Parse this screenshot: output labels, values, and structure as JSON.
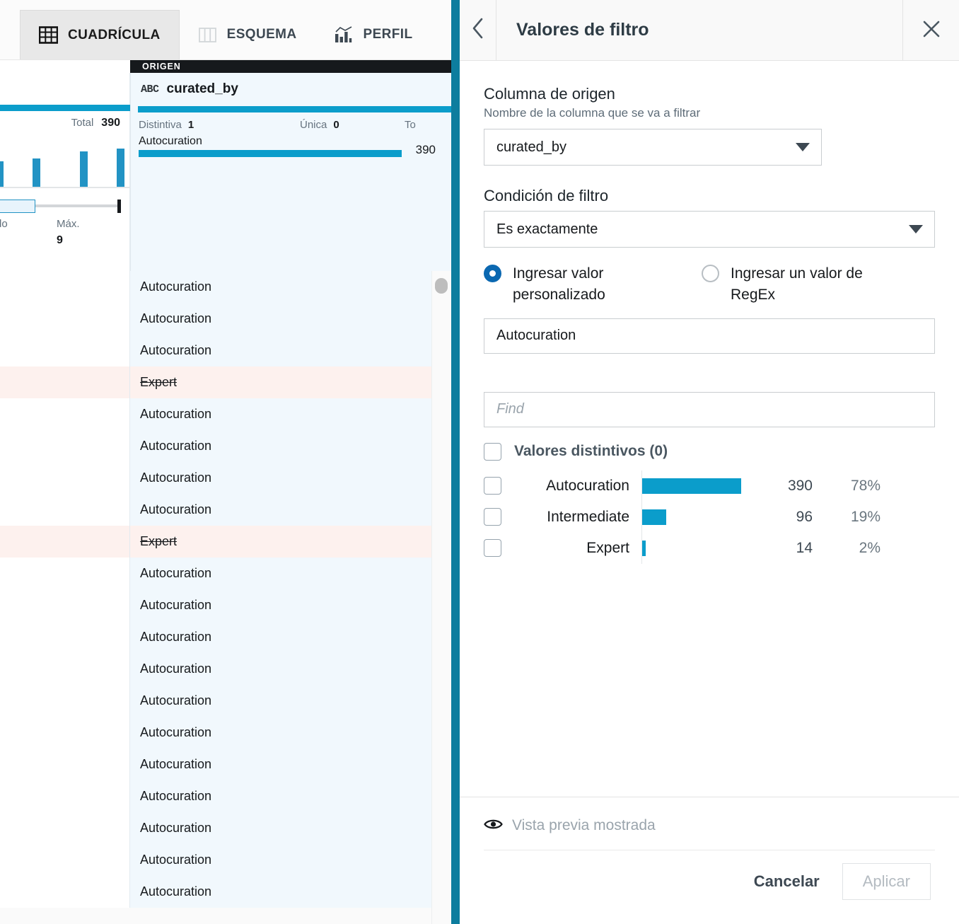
{
  "tabs": [
    {
      "id": "grid",
      "label": "CUADRÍCULA",
      "icon": "grid-icon",
      "active": true
    },
    {
      "id": "schema",
      "label": "ESQUEMA",
      "icon": "columns-icon",
      "active": false
    },
    {
      "id": "profile",
      "label": "PERFIL",
      "icon": "bar-chart-icon",
      "active": false
    }
  ],
  "profile": {
    "origin_label": "ORIGEN",
    "type_badge": "ABC",
    "column_name": "curated_by",
    "stats": [
      {
        "label": "Distintiva",
        "value": "1"
      },
      {
        "label": "Única",
        "value": "0"
      },
      {
        "label": "To",
        "value": ""
      }
    ],
    "value_name": "Autocuration",
    "value_count": "390",
    "left_card": {
      "total_label": "Total",
      "total_value": "390",
      "mode_label": "do",
      "max_label": "Máx.",
      "max_value": "9"
    }
  },
  "grid": {
    "rows": [
      {
        "value": "Autocuration",
        "struck": false
      },
      {
        "value": "Autocuration",
        "struck": false
      },
      {
        "value": "Autocuration",
        "struck": false
      },
      {
        "value": "Expert",
        "struck": true
      },
      {
        "value": "Autocuration",
        "struck": false
      },
      {
        "value": "Autocuration",
        "struck": false
      },
      {
        "value": "Autocuration",
        "struck": false
      },
      {
        "value": "Autocuration",
        "struck": false
      },
      {
        "value": "Expert",
        "struck": true
      },
      {
        "value": "Autocuration",
        "struck": false
      },
      {
        "value": "Autocuration",
        "struck": false
      },
      {
        "value": "Autocuration",
        "struck": false
      },
      {
        "value": "Autocuration",
        "struck": false
      },
      {
        "value": "Autocuration",
        "struck": false
      },
      {
        "value": "Autocuration",
        "struck": false
      },
      {
        "value": "Autocuration",
        "struck": false
      },
      {
        "value": "Autocuration",
        "struck": false
      },
      {
        "value": "Autocuration",
        "struck": false
      },
      {
        "value": "Autocuration",
        "struck": false
      },
      {
        "value": "Autocuration",
        "struck": false
      }
    ]
  },
  "panel": {
    "title": "Valores de filtro",
    "back_icon": "chevron-left-icon",
    "close_icon": "close-icon",
    "source_column": {
      "label": "Columna de origen",
      "sublabel": "Nombre de la columna que se va a filtrar",
      "value": "curated_by"
    },
    "condition": {
      "label": "Condición de filtro",
      "value": "Es exactamente"
    },
    "mode_options": [
      {
        "id": "custom",
        "label": "Ingresar valor personalizado",
        "selected": true
      },
      {
        "id": "regex",
        "label": "Ingresar un valor de RegEx",
        "selected": false
      }
    ],
    "value_input": "Autocuration",
    "find_placeholder": "Find",
    "distinct_header": "Valores distintivos (0)",
    "footer": {
      "preview_icon": "eye-icon",
      "preview_text": "Vista previa mostrada",
      "cancel_label": "Cancelar",
      "apply_label": "Aplicar"
    }
  },
  "chart_data": {
    "type": "bar",
    "title": "Valores distintivos (0)",
    "orientation": "horizontal",
    "categories": [
      "Autocuration",
      "Intermediate",
      "Expert"
    ],
    "values": [
      390,
      96,
      14
    ],
    "percents": [
      "78%",
      "19%",
      "2%"
    ],
    "bar_color": "#0b9dcb",
    "max_value": 390,
    "grid": false,
    "legend": "none"
  },
  "colors": {
    "accent_teal": "#0b9dcb",
    "divider_teal": "#0d7d9e",
    "radio_blue": "#0b68b1",
    "row_blue": "#f1f8fd",
    "row_pink": "#fdf1ee"
  }
}
